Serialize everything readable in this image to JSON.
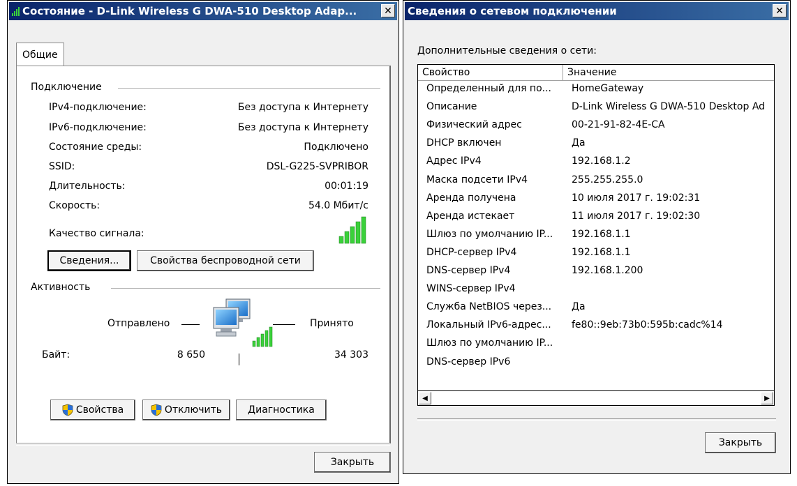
{
  "status_window": {
    "title": "Состояние - D-Link Wireless G DWA-510 Desktop Adap...",
    "tab_general": "Общие",
    "connection_group": "Подключение",
    "connection": [
      {
        "label": "IPv4-подключение:",
        "value": "Без доступа к Интернету"
      },
      {
        "label": "IPv6-подключение:",
        "value": "Без доступа к Интернету"
      },
      {
        "label": "Состояние среды:",
        "value": "Подключено"
      },
      {
        "label": "SSID:",
        "value": "DSL-G225-SVPRIBOR"
      },
      {
        "label": "Длительность:",
        "value": "00:01:19"
      },
      {
        "label": "Скорость:",
        "value": "54.0 Мбит/с"
      }
    ],
    "signal_label": "Качество сигнала:",
    "signal_bars": 5,
    "signal_color": "#3ad13a",
    "details_button": "Сведения...",
    "wireless_props_button": "Свойства беспроводной сети",
    "activity_group": "Активность",
    "sent_label": "Отправлено",
    "received_label": "Принято",
    "bytes_label": "Байт:",
    "bytes_sent": "8 650",
    "bytes_received": "34 303",
    "properties_button": "Свойства",
    "disable_button": "Отключить",
    "diagnose_button": "Диагностика",
    "close_button": "Закрыть",
    "shield_icon": "uac-shield-icon",
    "network_icon": "network-computers-icon"
  },
  "details_window": {
    "title": "Сведения о сетевом подключении",
    "subtitle": "Дополнительные сведения о сети:",
    "columns": [
      "Свойство",
      "Значение"
    ],
    "rows": [
      {
        "property": "Определенный для по...",
        "value": "HomeGateway"
      },
      {
        "property": "Описание",
        "value": "D-Link Wireless G DWA-510 Desktop Ad"
      },
      {
        "property": "Физический адрес",
        "value": "00-21-91-82-4E-CA"
      },
      {
        "property": "DHCP включен",
        "value": "Да"
      },
      {
        "property": "Адрес IPv4",
        "value": "192.168.1.2"
      },
      {
        "property": "Маска подсети IPv4",
        "value": "255.255.255.0"
      },
      {
        "property": "Аренда получена",
        "value": "10 июля 2017 г. 19:02:31"
      },
      {
        "property": "Аренда истекает",
        "value": "11 июля 2017 г. 19:02:30"
      },
      {
        "property": "Шлюз по умолчанию IP...",
        "value": "192.168.1.1"
      },
      {
        "property": "DHCP-сервер IPv4",
        "value": "192.168.1.1"
      },
      {
        "property": "DNS-сервер IPv4",
        "value": "192.168.1.200"
      },
      {
        "property": "WINS-сервер IPv4",
        "value": ""
      },
      {
        "property": "Служба NetBIOS через...",
        "value": "Да"
      },
      {
        "property": "Локальный IPv6-адрес...",
        "value": "fe80::9eb:73b0:595b:cadc%14"
      },
      {
        "property": "Шлюз по умолчанию IP...",
        "value": ""
      },
      {
        "property": "DNS-сервер IPv6",
        "value": ""
      }
    ],
    "close_button": "Закрыть"
  }
}
